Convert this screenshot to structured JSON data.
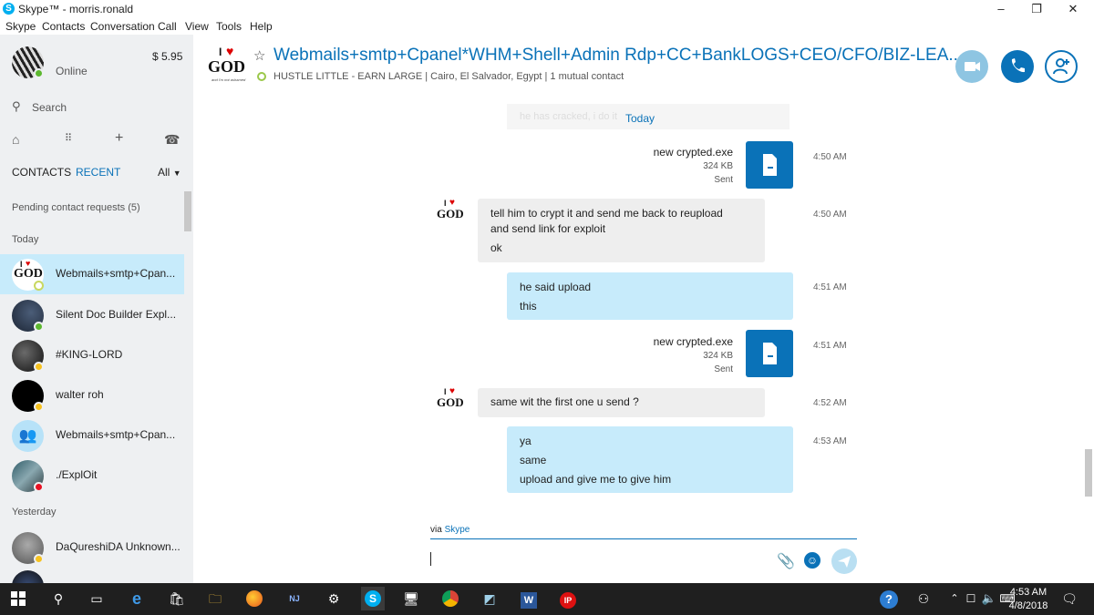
{
  "window": {
    "title": "Skype™ - morris.ronald",
    "controls": {
      "minimize": "–",
      "maximize": "❐",
      "close": "✕"
    }
  },
  "menu": [
    "Skype",
    "Contacts",
    "Conversation",
    "Call",
    "View",
    "Tools",
    "Help"
  ],
  "profile": {
    "status": "Online",
    "credit": "$ 5.95"
  },
  "search": {
    "placeholder": "Search"
  },
  "tabs": {
    "contacts": "CONTACTS",
    "recent": "RECENT",
    "filter": "All"
  },
  "pending": "Pending contact requests (5)",
  "sections": {
    "today": "Today",
    "yesterday": "Yesterday"
  },
  "contacts": [
    {
      "name": "Webmails+smtp+Cpan...",
      "status": "away-ring",
      "selected": true
    },
    {
      "name": "Silent Doc Builder Expl...",
      "status": "online"
    },
    {
      "name": "#KING-LORD",
      "status": "away"
    },
    {
      "name": "walter roh",
      "status": "away"
    },
    {
      "name": "Webmails+smtp+Cpan...",
      "status": "group"
    },
    {
      "name": "./ExplOit",
      "status": "dnd"
    },
    {
      "name": "DaQureshiDA Unknown...",
      "status": "away"
    }
  ],
  "conversation": {
    "title": "Webmails+smtp+Cpanel*WHM+Shell+Admin Rdp+CC+BankLOGS+CEO/CFO/BIZ-LEA...",
    "subtitle": "HUSTLE LITTLE - EARN LARGE | Cairo, El Salvador, Egypt | 1 mutual contact",
    "logo_text": {
      "i": "I",
      "god": "GOD",
      "sub": "and I'm not ashamed"
    }
  },
  "chat": {
    "date_divider": "Today",
    "faded_text": "he has cracked, i do it",
    "messages": [
      {
        "type": "file",
        "file_name": "new crypted.exe",
        "size": "324 KB",
        "status": "Sent",
        "time": "4:50 AM"
      },
      {
        "type": "in",
        "lines": [
          "tell him to crypt it and send me back to reupload",
          "and send link for exploit",
          "ok"
        ],
        "time": "4:50 AM"
      },
      {
        "type": "out",
        "lines": [
          "he said upload",
          "this"
        ],
        "time": "4:51 AM"
      },
      {
        "type": "file",
        "file_name": "new crypted.exe",
        "size": "324 KB",
        "status": "Sent",
        "time": "4:51 AM"
      },
      {
        "type": "in",
        "lines": [
          "same wit the first one u send ?"
        ],
        "time": "4:52 AM"
      },
      {
        "type": "out",
        "lines": [
          "ya",
          "same",
          "upload and give me to give him"
        ],
        "time": "4:53 AM"
      }
    ]
  },
  "compose": {
    "via": "via",
    "via_brand": "Skype"
  },
  "taskbar": {
    "time": "4:53 AM",
    "date": "4/8/2018"
  },
  "colors": {
    "accent": "#0a72b8",
    "skype_blue": "#00aff0",
    "bubble_out": "#c7ebfb",
    "bubble_in": "#eeeeee",
    "selected": "#c7ebfb",
    "sidebar_bg": "#eef0f2"
  }
}
